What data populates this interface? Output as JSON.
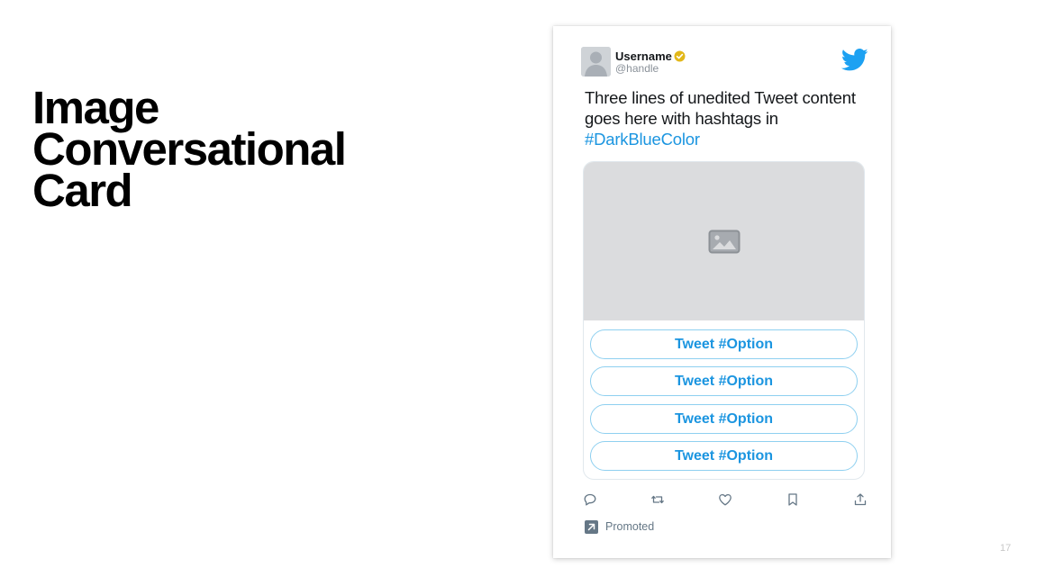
{
  "slide": {
    "title_lines": [
      "Image",
      "Conversational",
      "Card"
    ],
    "page_number": "17"
  },
  "tweet": {
    "username": "Username",
    "handle": "@handle",
    "text_line": "Three lines of unedited Tweet content goes here with hashtags in",
    "hashtag": "#DarkBlueColor",
    "options": [
      {
        "label": "Tweet #Option"
      },
      {
        "label": "Tweet #Option"
      },
      {
        "label": "Tweet #Option"
      },
      {
        "label": "Tweet #Option"
      }
    ],
    "promoted_label": "Promoted"
  },
  "icons": {
    "logo": "twitter-bird-icon",
    "verified": "verified-badge-icon",
    "media": "image-icon",
    "actions": [
      "reply-icon",
      "retweet-icon",
      "like-icon",
      "bookmark-icon",
      "share-icon"
    ],
    "promoted": "promoted-arrow-icon"
  },
  "colors": {
    "link": "#1b95e0",
    "verified": "#e2b719",
    "option_border": "#8fd0f0",
    "placeholder": "#dbdcde",
    "muted": "#657786"
  }
}
